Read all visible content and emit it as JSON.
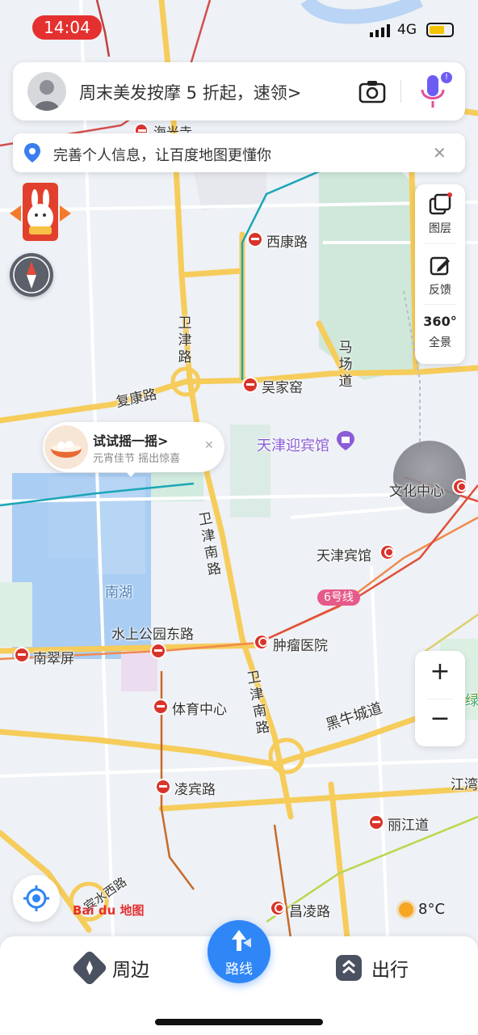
{
  "status_bar": {
    "time": "14:04",
    "network": "4G"
  },
  "search_bar": {
    "promo_text": "周末美发按摩 5 折起，速领>"
  },
  "info_banner": {
    "text": "完善个人信息，让百度地图更懂你"
  },
  "right_panel": {
    "layers_label": "图层",
    "feedback_label": "反馈",
    "panorama_label": "全景",
    "panorama_icon_text": "360°"
  },
  "shake_popup": {
    "title": "试试摇一摇",
    "arrow": ">",
    "subtitle": "元宵佳节 摇出惊喜"
  },
  "map_labels": {
    "xikang_road": "西康路",
    "weijin_road": "卫津路",
    "wujiayao": "吴家窑",
    "machang_road": "马场道",
    "fukang_road": "复康路",
    "guesthouse": "天津迎宾馆",
    "culture_center": "文化中心",
    "tianjin_hotel": "天津宾馆",
    "line6": "6号线",
    "weijin_south_road": "卫津南路",
    "weijin_south_road2": "卫津南路",
    "nanhu": "南湖",
    "water_park_east_road": "水上公园东路",
    "nancuiping": "南翠屏",
    "tumor_hospital": "肿瘤医院",
    "sports_center": "体育中心",
    "heiniucheng_road": "黑牛城道",
    "lingbin_road": "凌宾路",
    "lijiang_road": "丽江道",
    "jiangwan": "江湾",
    "changling_road": "昌凌路",
    "green_edge": "绿",
    "haiguangsi": "海光寺",
    "binshui_road": "宾水西路"
  },
  "brand": {
    "logo_text": "Bai du 地图"
  },
  "weather": {
    "temperature": "8°C"
  },
  "zoom": {
    "in": "+",
    "out": "−"
  },
  "bottom_nav": {
    "nearby": "周边",
    "route": "路线",
    "travel": "出行"
  },
  "colors": {
    "accent": "#2f86f6",
    "metro_red": "#d9342b",
    "road_yellow": "#f6cc5a"
  }
}
